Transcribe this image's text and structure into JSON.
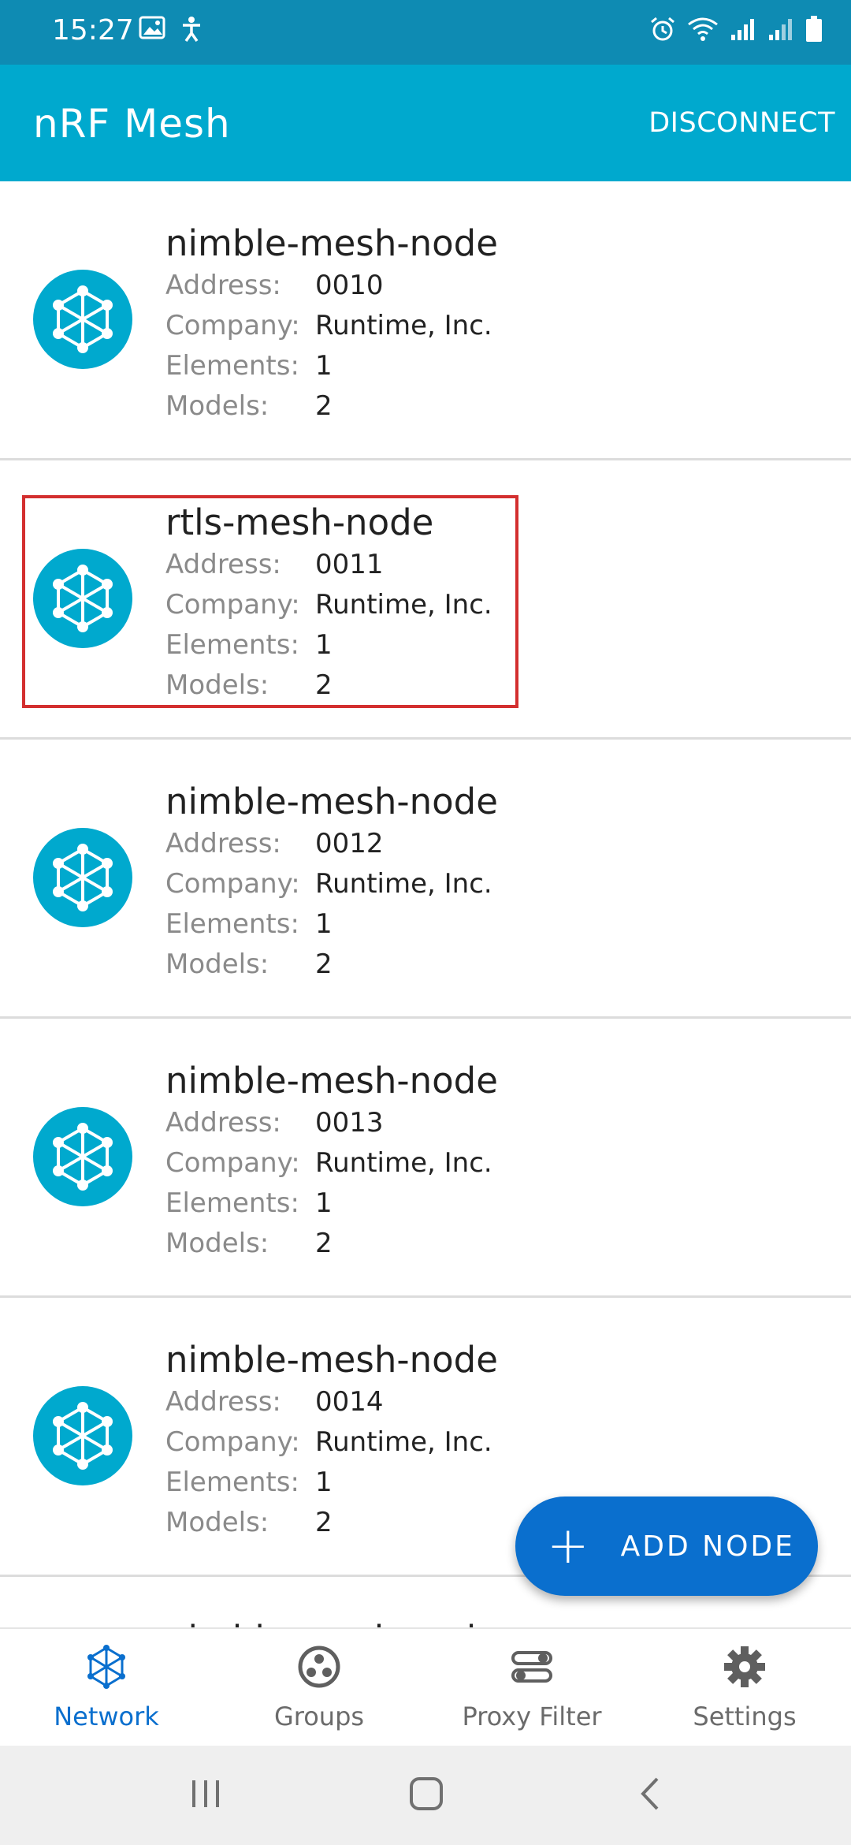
{
  "status_bar": {
    "time": "15:27",
    "left_icons": [
      "image-icon",
      "accessibility-icon"
    ],
    "right_icons": [
      "alarm-icon",
      "wifi-icon",
      "signal-icon",
      "signal-icon-2",
      "battery-icon"
    ]
  },
  "app_bar": {
    "title": "nRF Mesh",
    "action_label": "DISCONNECT"
  },
  "labels": {
    "address": "Address:",
    "company": "Company:",
    "elements": "Elements:",
    "models": "Models:"
  },
  "nodes": [
    {
      "name": "nimble-mesh-node",
      "address": "0010",
      "company": "Runtime, Inc.",
      "elements": "1",
      "models": "2"
    },
    {
      "name": "rtls-mesh-node",
      "address": "0011",
      "company": "Runtime, Inc.",
      "elements": "1",
      "models": "2"
    },
    {
      "name": "nimble-mesh-node",
      "address": "0012",
      "company": "Runtime, Inc.",
      "elements": "1",
      "models": "2"
    },
    {
      "name": "nimble-mesh-node",
      "address": "0013",
      "company": "Runtime, Inc.",
      "elements": "1",
      "models": "2"
    },
    {
      "name": "nimble-mesh-node",
      "address": "0014",
      "company": "Runtime, Inc.",
      "elements": "1",
      "models": "2"
    },
    {
      "name": "nimble-mesh-node"
    }
  ],
  "fab": {
    "label": "ADD NODE",
    "icon": "plus-icon"
  },
  "bottom_nav": [
    {
      "label": "Network",
      "icon": "network-icon",
      "active": true
    },
    {
      "label": "Groups",
      "icon": "groups-icon",
      "active": false
    },
    {
      "label": "Proxy Filter",
      "icon": "proxy-filter-icon",
      "active": false
    },
    {
      "label": "Settings",
      "icon": "settings-icon",
      "active": false
    }
  ],
  "colors": {
    "status_bar": "#0e8bb3",
    "app_bar": "#00a9ce",
    "accent": "#0a6fce",
    "highlight": "#d32f2f"
  }
}
